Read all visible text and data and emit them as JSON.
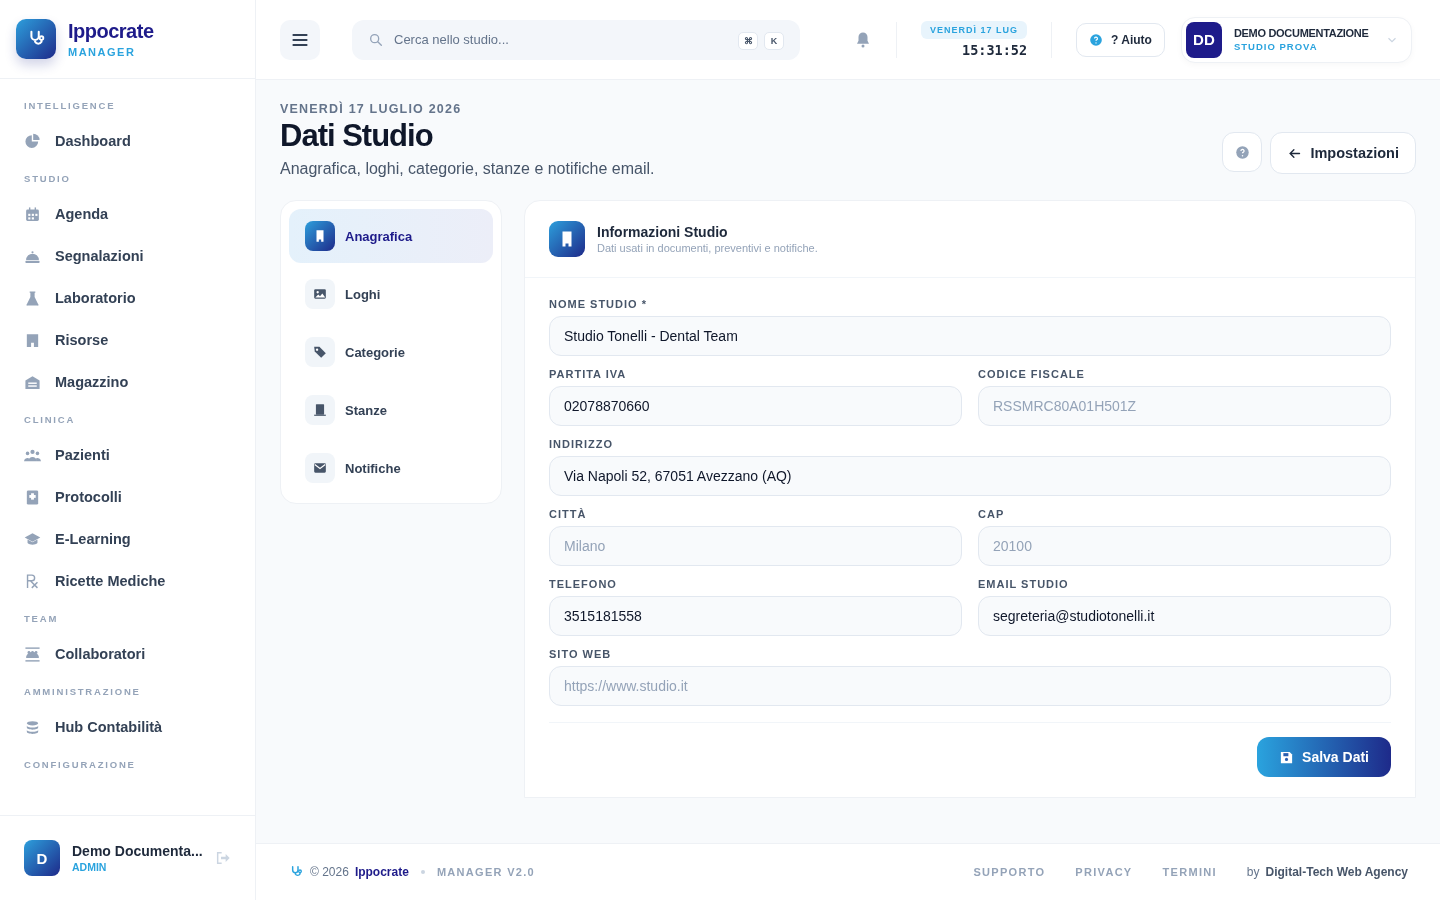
{
  "brand": {
    "name": "Ippocrate",
    "subtitle": "MANAGER"
  },
  "sidebar": {
    "sections": [
      {
        "title": "INTELLIGENCE",
        "items": [
          {
            "label": "Dashboard",
            "selected": false
          }
        ]
      },
      {
        "title": "STUDIO",
        "items": [
          {
            "label": "Agenda",
            "selected": false
          },
          {
            "label": "Segnalazioni",
            "selected": false
          },
          {
            "label": "Laboratorio",
            "selected": false
          },
          {
            "label": "Risorse",
            "selected": false
          },
          {
            "label": "Magazzino",
            "selected": false
          }
        ]
      },
      {
        "title": "CLINICA",
        "items": [
          {
            "label": "Pazienti",
            "selected": false
          },
          {
            "label": "Protocolli",
            "selected": false
          },
          {
            "label": "E-Learning",
            "selected": false
          },
          {
            "label": "Ricette Mediche",
            "selected": false
          }
        ]
      },
      {
        "title": "TEAM",
        "items": [
          {
            "label": "Collaboratori",
            "selected": false
          }
        ]
      },
      {
        "title": "AMMINISTRAZIONE",
        "items": [
          {
            "label": "Hub Contabilità",
            "selected": false
          }
        ]
      },
      {
        "title": "CONFIGURAZIONE"
      }
    ],
    "user": {
      "initial": "D",
      "name": "Demo Documenta...",
      "role": "ADMIN"
    }
  },
  "header": {
    "search": {
      "placeholder": "Cerca nello studio...",
      "keys": [
        "⌘",
        "K"
      ]
    },
    "date": "VENERDÌ 17 LUG",
    "time": "15:31:52",
    "help": "? Aiuto",
    "account": {
      "initials": "DD",
      "name": "DEMO DOCUMENTAZIONE",
      "studio": "STUDIO PROVA"
    }
  },
  "page": {
    "date": "VENERDÌ 17 LUGLIO 2026",
    "title": "Dati Studio",
    "subtitle": "Anagrafica, loghi, categorie, stanze e notifiche email.",
    "back": "Impostazioni"
  },
  "settings_nav": [
    {
      "label": "Anagrafica",
      "selected": true
    },
    {
      "label": "Loghi",
      "selected": false
    },
    {
      "label": "Categorie",
      "selected": false
    },
    {
      "label": "Stanze",
      "selected": false
    },
    {
      "label": "Notifiche",
      "selected": false
    }
  ],
  "form": {
    "title": "Informazioni Studio",
    "subtitle": "Dati usati in documenti, preventivi e notifiche.",
    "rows": [
      [
        {
          "label": "NOME STUDIO *",
          "value": "Studio Tonelli - Dental Team"
        }
      ],
      [
        {
          "label": "PARTITA IVA",
          "value": "02078870660"
        },
        {
          "label": "CODICE FISCALE",
          "placeholder": "RSSMRC80A01H501Z"
        }
      ],
      [
        {
          "label": "INDIRIZZO",
          "value": "Via Napoli 52, 67051 Avezzano (AQ)"
        }
      ],
      [
        {
          "label": "CITTÀ",
          "placeholder": "Milano"
        },
        {
          "label": "CAP",
          "placeholder": "20100"
        }
      ],
      [
        {
          "label": "TELEFONO",
          "value": "3515181558"
        },
        {
          "label": "EMAIL STUDIO",
          "value": "segreteria@studiotonelli.it"
        }
      ],
      [
        {
          "label": "SITO WEB",
          "placeholder": "https://www.studio.it"
        }
      ]
    ],
    "save": "Salva Dati"
  },
  "footer": {
    "copyright": "© 2026",
    "brand": "Ippocrate",
    "version": "MANAGER V2.0",
    "links": [
      "SUPPORTO",
      "PRIVACY",
      "TERMINI"
    ],
    "by": "by",
    "agency": "Digital-Tech Web Agency"
  }
}
